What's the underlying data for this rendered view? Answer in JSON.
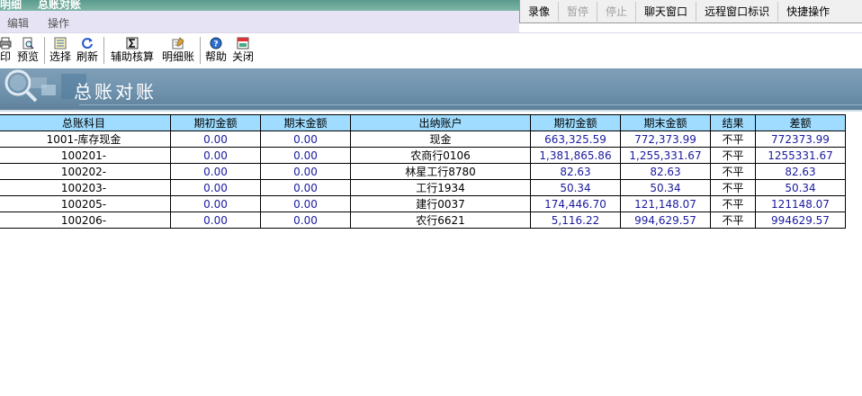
{
  "window": {
    "title_left": "明细",
    "title_tab": "总账对账"
  },
  "recorder": {
    "buttons": [
      "录像",
      "暂停",
      "停止",
      "聊天窗口",
      "远程窗口标识",
      "快捷操作"
    ]
  },
  "menu": {
    "items": [
      "编辑",
      "操作"
    ]
  },
  "toolbar": {
    "items": [
      {
        "label": "印",
        "icon": "print-icon"
      },
      {
        "label": "预览",
        "icon": "preview-icon"
      },
      {
        "label": "选择",
        "icon": "select-icon"
      },
      {
        "label": "刷新",
        "icon": "refresh-icon"
      },
      {
        "label": "辅助核算",
        "icon": "sigma-icon"
      },
      {
        "label": "明细账",
        "icon": "ledger-icon"
      },
      {
        "label": "帮助",
        "icon": "help-icon"
      },
      {
        "label": "关闭",
        "icon": "close-icon"
      }
    ]
  },
  "banner": {
    "title": "总账对账"
  },
  "table": {
    "headers": [
      "总账科目",
      "期初金额",
      "期末金额",
      "出纳账户",
      "期初金额",
      "期末金额",
      "结果",
      "差额"
    ],
    "rows": [
      [
        "1001-库存现金",
        "0.00",
        "0.00",
        "现金",
        "663,325.59",
        "772,373.99",
        "不平",
        "772373.99"
      ],
      [
        "100201-",
        "0.00",
        "0.00",
        "农商行0106",
        "1,381,865.86",
        "1,255,331.67",
        "不平",
        "1255331.67"
      ],
      [
        "100202-",
        "0.00",
        "0.00",
        "林星工行8780",
        "82.63",
        "82.63",
        "不平",
        "82.63"
      ],
      [
        "100203-",
        "0.00",
        "0.00",
        "工行1934",
        "50.34",
        "50.34",
        "不平",
        "50.34"
      ],
      [
        "100205-",
        "0.00",
        "0.00",
        "建行0037",
        "174,446.70",
        "121,148.07",
        "不平",
        "121148.07"
      ],
      [
        "100206-",
        "0.00",
        "0.00",
        "农行6621",
        "5,116.22",
        "994,629.57",
        "不平",
        "994629.57"
      ]
    ]
  }
}
